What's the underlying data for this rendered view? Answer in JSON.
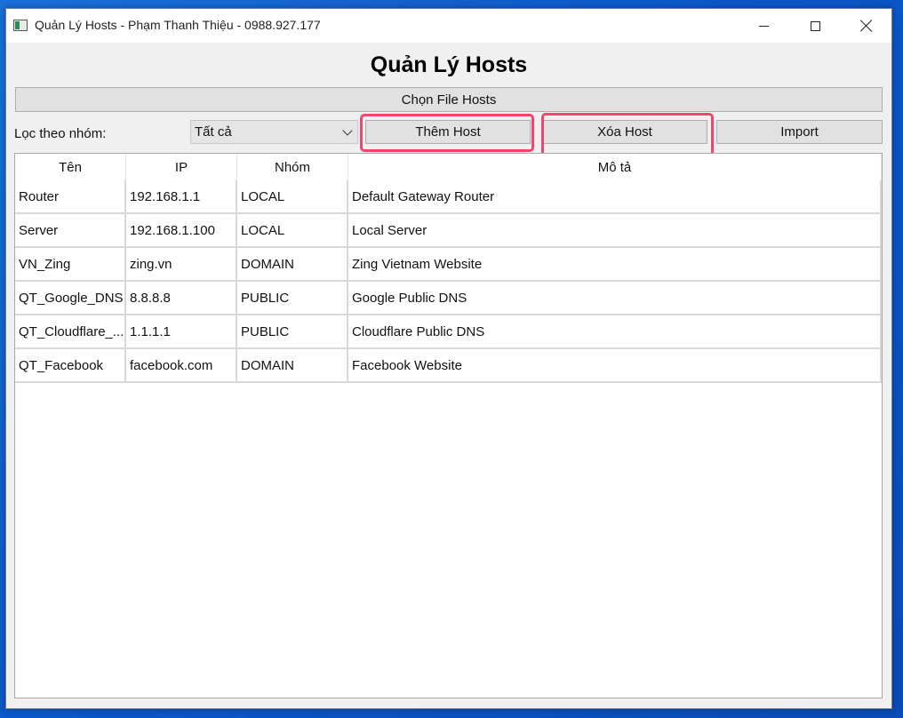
{
  "window": {
    "title": "Quản Lý Hosts - Phạm Thanh Thiệu - 0988.927.177"
  },
  "heading": "Quản Lý Hosts",
  "toolbar": {
    "choose_file_label": "Chọn File Hosts",
    "filter_label": "Lọc theo nhóm:",
    "filter_value": "Tất cả",
    "add_label": "Thêm Host",
    "delete_label": "Xóa Host",
    "import_label": "Import"
  },
  "table": {
    "headers": [
      "Tên",
      "IP",
      "Nhóm",
      "Mô tả"
    ],
    "rows": [
      [
        "Router",
        "192.168.1.1",
        "LOCAL",
        "Default Gateway Router"
      ],
      [
        "Server",
        "192.168.1.100",
        "LOCAL",
        "Local Server"
      ],
      [
        "VN_Zing",
        "zing.vn",
        "DOMAIN",
        "Zing Vietnam Website"
      ],
      [
        "QT_Google_DNS",
        "8.8.8.8",
        "PUBLIC",
        "Google Public DNS"
      ],
      [
        "QT_Cloudflare_...",
        "1.1.1.1",
        "PUBLIC",
        "Cloudflare Public DNS"
      ],
      [
        "QT_Facebook",
        "facebook.com",
        "DOMAIN",
        "Facebook Website"
      ]
    ]
  },
  "colors": {
    "highlight": "#f0456f",
    "desktop": "#0b57c9"
  },
  "icons": [
    "app-icon",
    "minimize-icon",
    "maximize-icon",
    "close-icon",
    "chevron-down-icon"
  ]
}
